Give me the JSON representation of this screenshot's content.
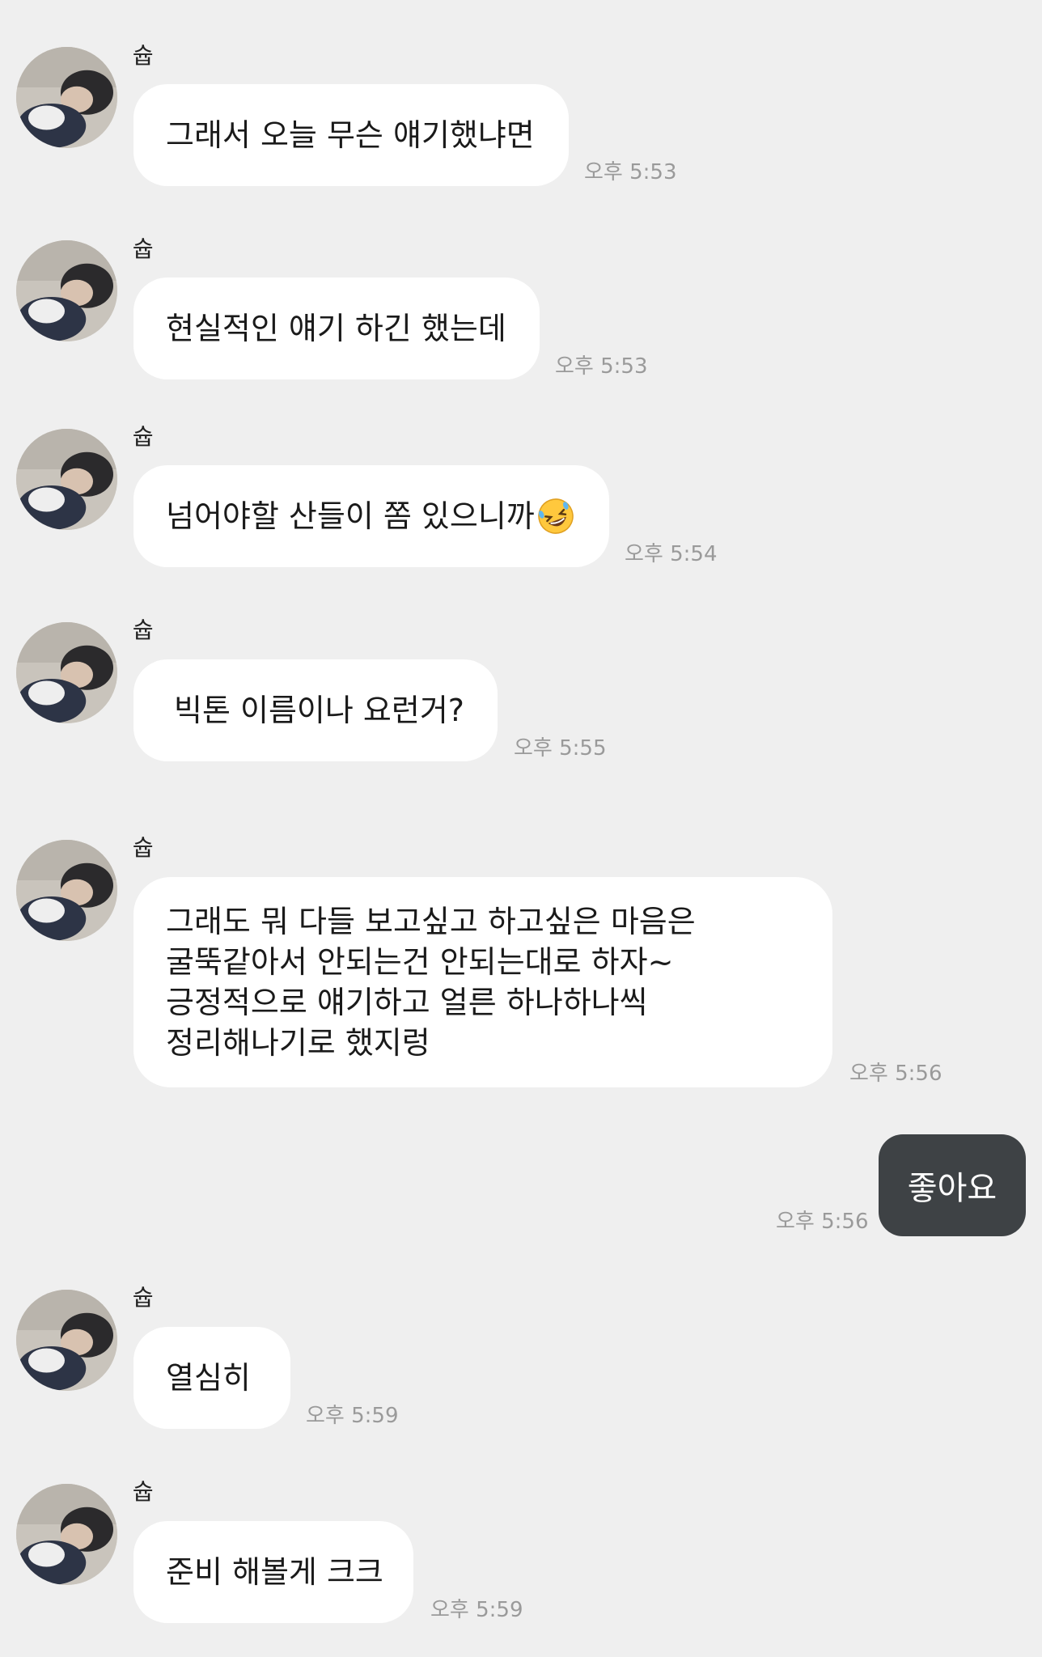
{
  "sender_name": "슙",
  "messages": [
    {
      "text": "그래서 오늘 무슨 얘기했냐면",
      "time": "오후 5:53"
    },
    {
      "text": "현실적인 얘기 하긴 했는데",
      "time": "오후 5:53"
    },
    {
      "text": "넘어야할 산들이 쫌 있으니까",
      "emoji": "rolling-on-floor-laughing",
      "time": "오후 5:54"
    },
    {
      "text": "빅톤 이름이나 요런거?",
      "time": "오후 5:55"
    },
    {
      "lines": [
        "그래도 뭐 다들 보고싶고 하고싶은 마음은",
        "굴뚝같아서 안되는건 안되는대로 하자~",
        "긍정적으로 얘기하고 얼른 하나하나씩",
        "정리해나기로 했지렁"
      ],
      "time": "오후 5:56"
    },
    {
      "text": "열심히",
      "time": "오후 5:59"
    },
    {
      "text": "준비 해볼게 크크",
      "time": "오후 5:59"
    }
  ],
  "my_message": {
    "text": "좋아요",
    "time": "오후 5:56"
  },
  "colors": {
    "background": "#efefef",
    "incoming_bubble": "#ffffff",
    "outgoing_bubble": "#3e4245",
    "timestamp": "#9a9a9a"
  }
}
